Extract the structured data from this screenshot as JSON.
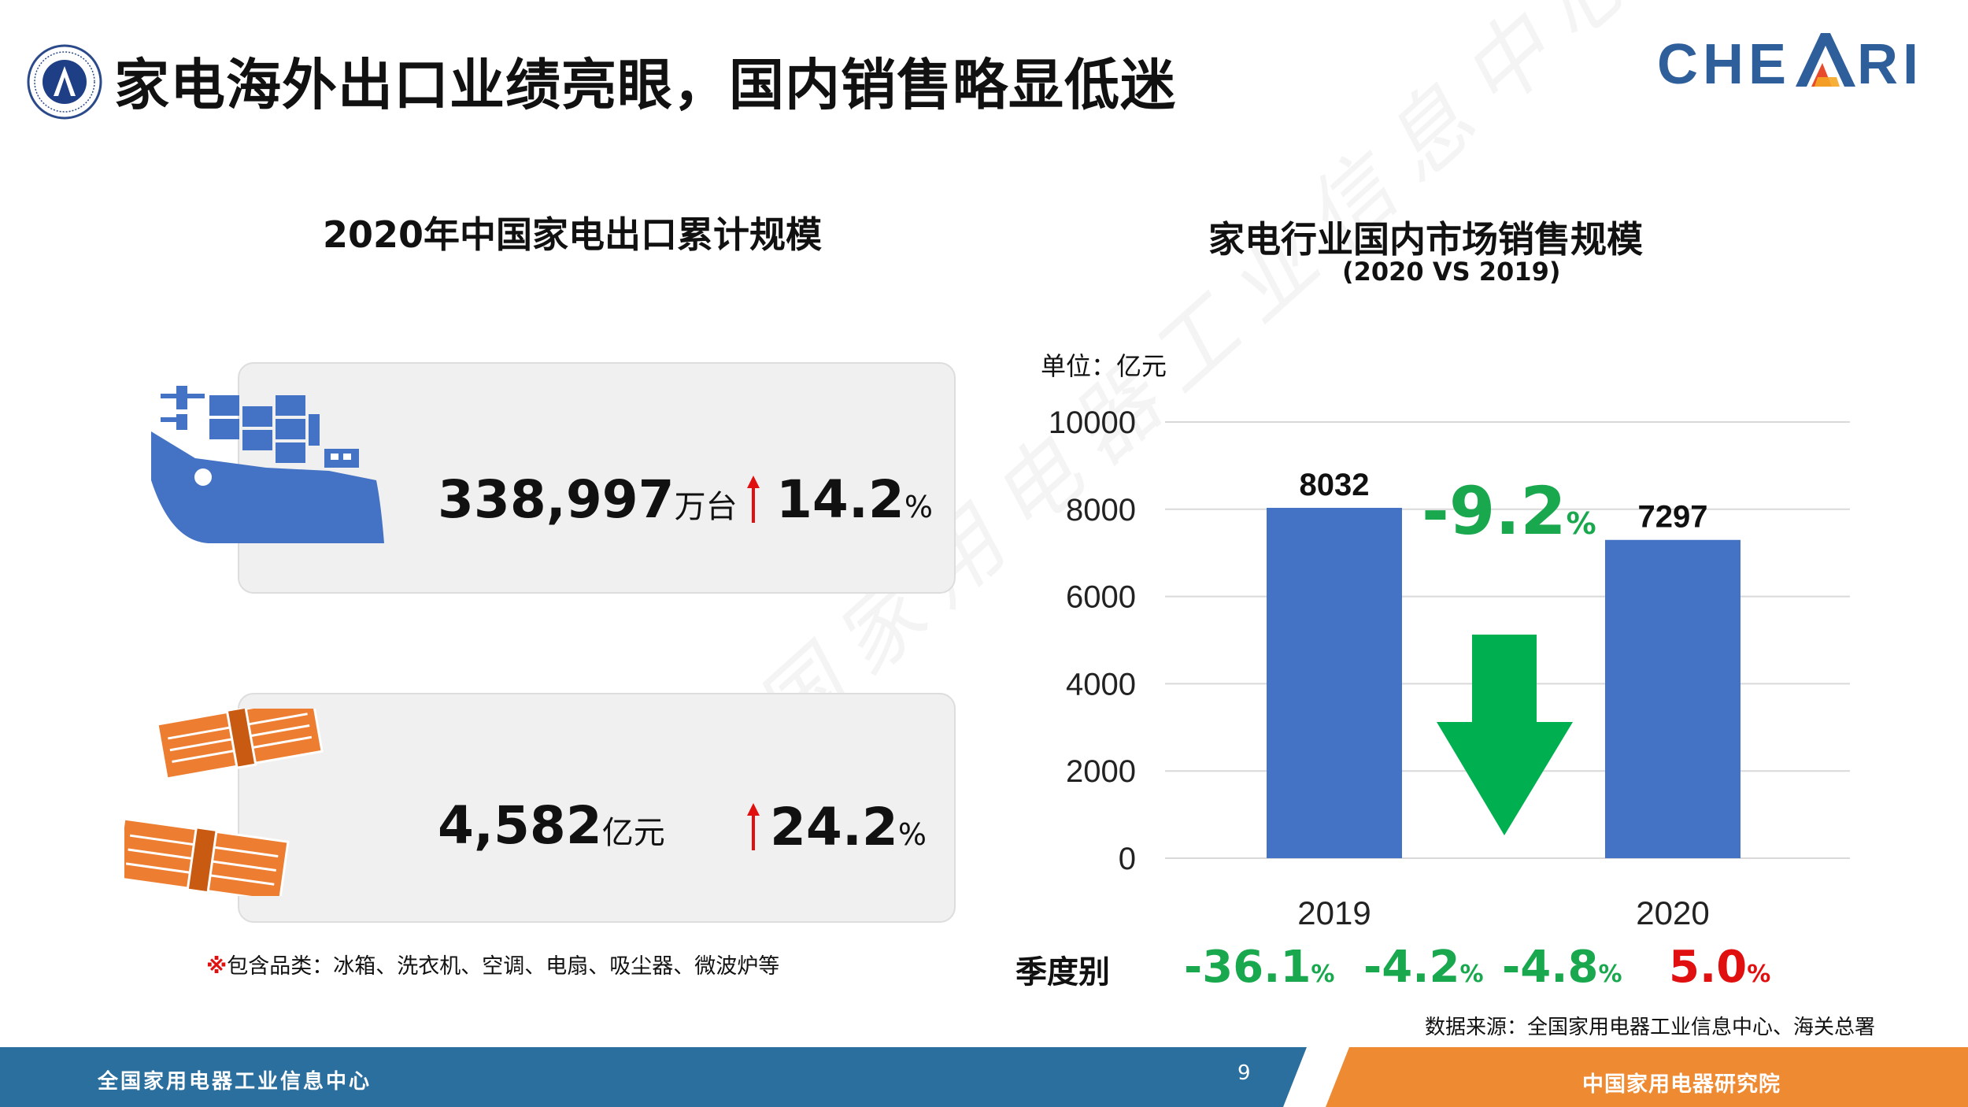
{
  "header": {
    "title": "家电海外出口业绩亮眼，国内销售略显低迷",
    "brand": "CHE RI"
  },
  "left": {
    "title": "2020年中国家电出口累计规模",
    "export_volume": {
      "value": "338,997",
      "unit": "万台",
      "growth": "14.2",
      "growth_unit": "%"
    },
    "export_value": {
      "value": "4,582",
      "unit": "亿元",
      "growth": "24.2",
      "growth_unit": "%"
    },
    "note_mark": "※",
    "note": "包含品类：冰箱、洗衣机、空调、电扇、吸尘器、微波炉等"
  },
  "right": {
    "title": "家电行业国内市场销售规模",
    "subtitle": "(2020 VS 2019)",
    "unit_label": "单位：亿元",
    "change_value": "-9.2",
    "change_unit": "%",
    "quarter_label": "季度别",
    "quarters": [
      {
        "value": "-36.1",
        "unit": "%",
        "color": "#1aa84f"
      },
      {
        "value": "-4.2",
        "unit": "%",
        "color": "#1aa84f"
      },
      {
        "value": "-4.8",
        "unit": "%",
        "color": "#1aa84f"
      },
      {
        "value": "5.0",
        "unit": "%",
        "color": "#e01010"
      }
    ],
    "source": "数据来源：全国家用电器工业信息中心、海关总署"
  },
  "chart_data": {
    "type": "bar",
    "categories": [
      "2019",
      "2020"
    ],
    "values": [
      8032,
      7297
    ],
    "ylim": [
      0,
      10000
    ],
    "yticks": [
      "0",
      "2000",
      "4000",
      "6000",
      "8000",
      "10000"
    ],
    "grid": true,
    "bar_color": "#4472c4",
    "arrow_color": "#00b050"
  },
  "footer": {
    "left_text": "全国家用电器工业信息中心",
    "page_number": "9",
    "right_text": "中国家用电器研究院"
  },
  "watermark": "国家用电器工业信息中心",
  "colors": {
    "accent_blue": "#2e5f9a",
    "footer_blue": "#2a6f9d",
    "footer_orange": "#ee8a32",
    "up_red": "#e01010",
    "green": "#1aa84f"
  }
}
